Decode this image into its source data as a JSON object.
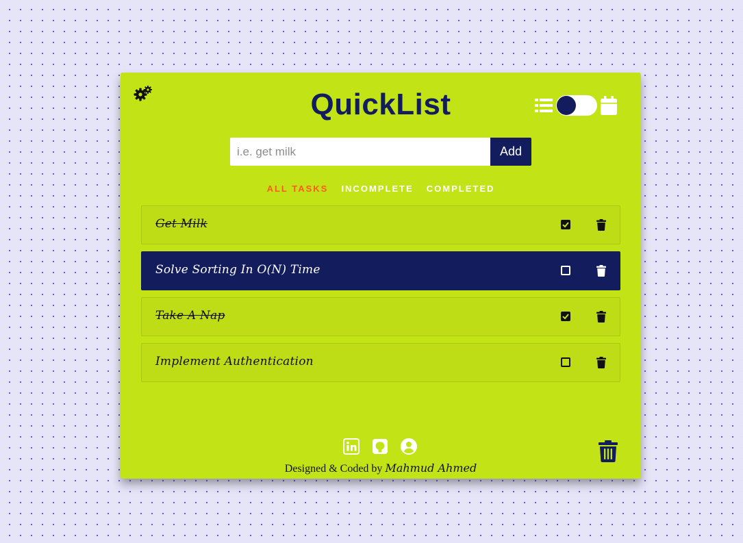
{
  "app": {
    "title": "QuickList"
  },
  "icons": {
    "settings": "gears-icon",
    "list_view": "list-icon",
    "calendar_view": "calendar-icon",
    "delete": "trash-icon",
    "linkedin": "linkedin-icon",
    "github": "github-icon",
    "profile": "user-circle-icon",
    "clear_all": "trash-can-icon"
  },
  "colors": {
    "card": "#c2e416",
    "navy": "#131d5e",
    "active_filter": "#ff5a1f",
    "background": "#e6e4f8"
  },
  "add_task": {
    "placeholder": "i.e. get milk",
    "value": "",
    "button_label": "Add"
  },
  "filters": [
    {
      "label": "ALL TASKS",
      "active": true
    },
    {
      "label": "INCOMPLETE",
      "active": false
    },
    {
      "label": "COMPLETED",
      "active": false
    }
  ],
  "tasks": [
    {
      "text": "Get Milk",
      "completed": true
    },
    {
      "text": "Solve Sorting In O(N) Time",
      "completed": false
    },
    {
      "text": "Take A Nap",
      "completed": true
    },
    {
      "text": "Implement Authentication",
      "completed": false
    }
  ],
  "footer": {
    "credit_prefix": "Designed & Coded by",
    "author": "Mahmud Ahmed"
  }
}
